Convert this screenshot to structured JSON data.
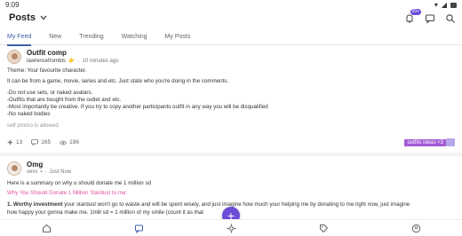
{
  "status_bar": {
    "time": "9:09"
  },
  "header": {
    "title": "Posts",
    "notification_badge": "99+"
  },
  "tabs": [
    {
      "label": "My Feed",
      "active": true
    },
    {
      "label": "New",
      "active": false
    },
    {
      "label": "Trending",
      "active": false
    },
    {
      "label": "Watching",
      "active": false
    },
    {
      "label": "My Posts",
      "active": false
    }
  ],
  "post1": {
    "title": "Outfit comp",
    "author": "lawrencefrombts",
    "timestamp": "10 minutes ago",
    "lines": [
      "Theme: Your favourite character.",
      "It can be from a game, movie, series and etc. Just state who you're doing in the comments.",
      "-Do not use sets, or naked avatars.",
      "-Outfits that are bought from the outlet and etc.",
      "-Most importantly be creative. If you try to copy another participants outfit in any way you will be disqualified",
      "-No naked bodies",
      "self promo is allowed"
    ],
    "likes": "13",
    "comments": "165",
    "views": "196",
    "tag": "outfits ideas <3"
  },
  "post2": {
    "title": "Omg",
    "author": "vevv",
    "timestamp": "Just Now",
    "line1": "Here is a summary on why u should donate me 1 million sd",
    "line2": "Why You Should Donate 1 Million Stardust to me:",
    "line3_bold": "1. Worthy investment",
    "line3_rest": " your stardust won't go to waste and will be spent wisely, and just imagine how much your helping me by donating to me right now, just imagine",
    "line4": "how happy your gonna make me. 1mill sd = 1 million of my smile (count it as that"
  },
  "colors": {
    "accent": "#3c5fa8",
    "fab": "#6a4cd6",
    "tag": "#a45ad6",
    "pink": "#e0529c"
  }
}
